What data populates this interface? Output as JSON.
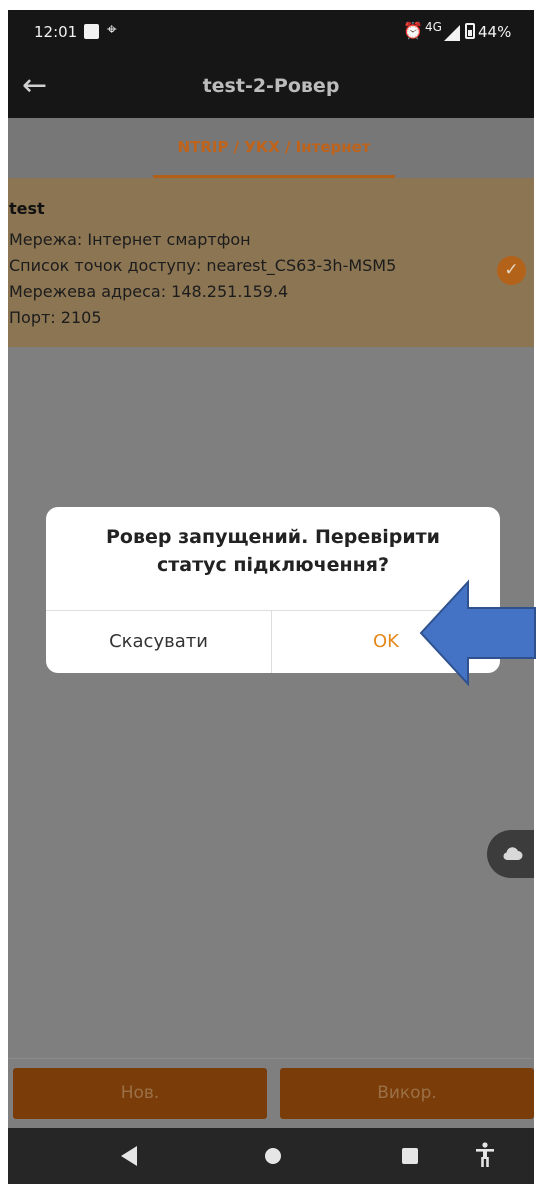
{
  "status_bar": {
    "time": "12:01",
    "network": "4G",
    "battery": "44%"
  },
  "app_bar": {
    "title": "test-2-Ровер"
  },
  "tabs": [
    {
      "label": "NTRIP / УКХ / Інтернет",
      "active": true
    }
  ],
  "config_card": {
    "name": "test",
    "lines": [
      "Мережа: Інтернет смартфон",
      "Список точок доступу: nearest_CS63-3h-MSM5",
      "Мережева адреса: 148.251.159.4",
      "Порт: 2105"
    ],
    "selected": true
  },
  "dialog": {
    "message_line1": "Ровер запущений. Перевірити",
    "message_line2": "статус підключення?",
    "cancel_label": "Скасувати",
    "ok_label": "OK"
  },
  "bottom_buttons": {
    "new_label": "Нов.",
    "use_label": "Викор."
  },
  "colors": {
    "accent": "#e48a1c",
    "tab_active": "#c0631a",
    "card_bg": "#8b7553",
    "scrim": "#7f7f7f",
    "arrow_fill": "#4472c4",
    "arrow_stroke": "#2f528f"
  },
  "icons": {
    "back": "arrow-left-icon",
    "check": "check-circle-icon",
    "cloud": "cloud-icon",
    "annotation": "left-arrow-pointer-icon"
  }
}
